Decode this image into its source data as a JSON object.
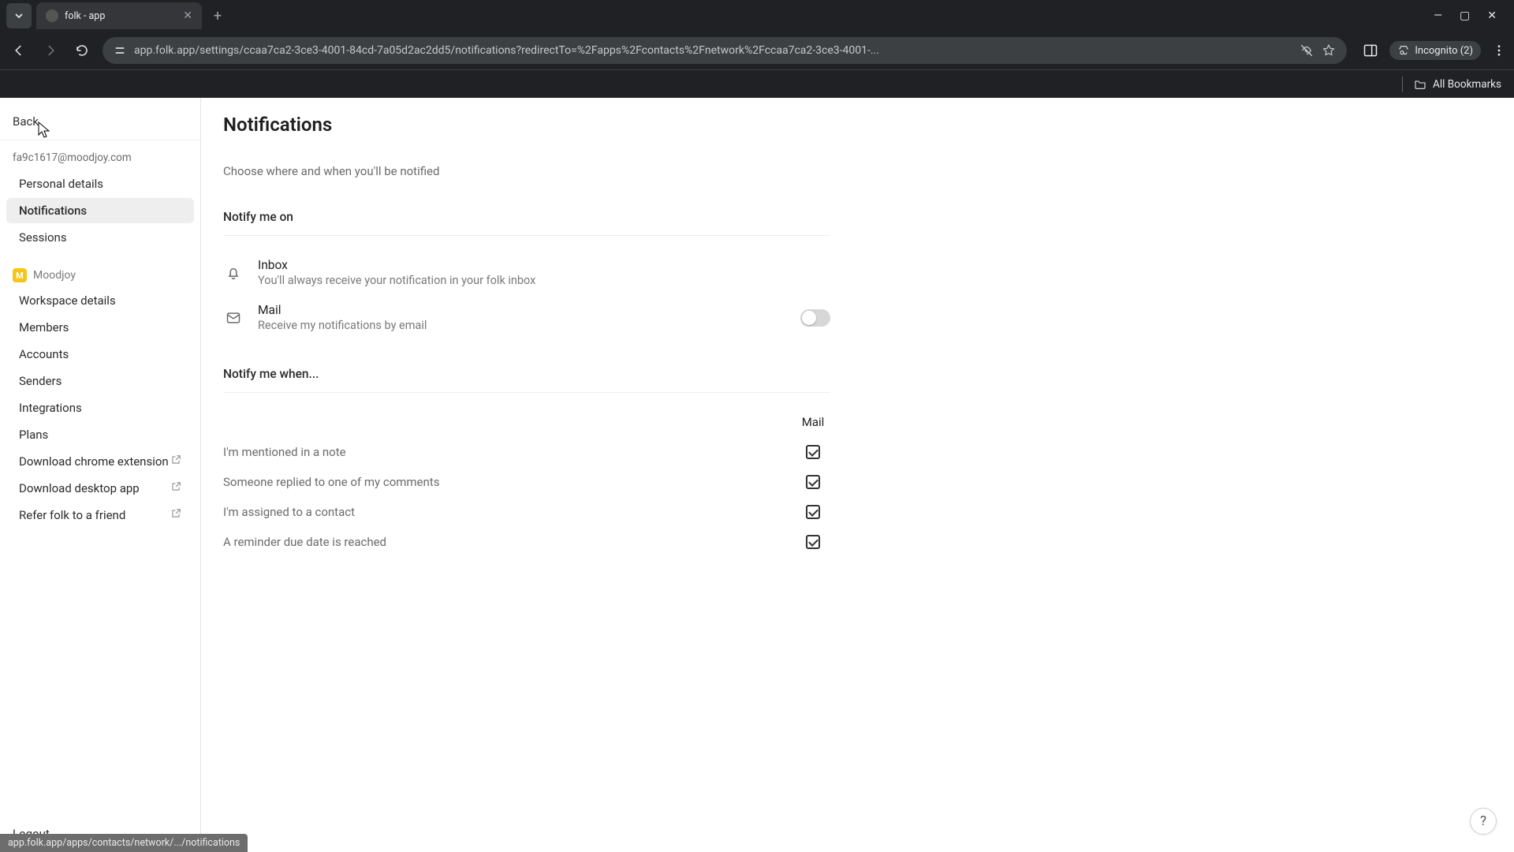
{
  "browser": {
    "tab_title": "folk - app",
    "url": "app.folk.app/settings/ccaa7ca2-3ce3-4001-84cd-7a05d2ac2dd5/notifications?redirectTo=%2Fapps%2Fcontacts%2Fnetwork%2Fccaa7ca2-3ce3-4001-...",
    "incognito_label": "Incognito (2)",
    "all_bookmarks": "All Bookmarks",
    "status_text": "app.folk.app/apps/contacts/network/.../notifications"
  },
  "sidebar": {
    "back": "Back",
    "email": "fa9c1617@moodjoy.com",
    "personal": {
      "details": "Personal details",
      "notifications": "Notifications",
      "sessions": "Sessions"
    },
    "workspace": {
      "badge": "M",
      "name": "Moodjoy",
      "items": {
        "details": "Workspace details",
        "members": "Members",
        "accounts": "Accounts",
        "senders": "Senders",
        "integrations": "Integrations",
        "plans": "Plans",
        "chrome_ext": "Download chrome extension",
        "desktop": "Download desktop app",
        "refer": "Refer folk to a friend"
      }
    },
    "logout": "Logout"
  },
  "page": {
    "title": "Notifications",
    "subtitle": "Choose where and when you'll be notified",
    "notify_on": {
      "heading": "Notify me on",
      "inbox": {
        "title": "Inbox",
        "desc": "You'll always receive your notification in your folk inbox"
      },
      "mail": {
        "title": "Mail",
        "desc": "Receive my notifications by email"
      }
    },
    "notify_when": {
      "heading": "Notify me when...",
      "mail_col": "Mail",
      "rows": {
        "mentioned": "I'm mentioned in a note",
        "replied": "Someone replied to one of my comments",
        "assigned": "I'm assigned to a contact",
        "reminder": "A reminder due date is reached"
      }
    }
  },
  "help": "?"
}
